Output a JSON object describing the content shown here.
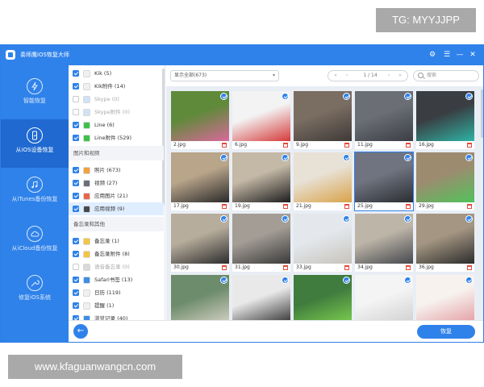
{
  "watermark_top": "TG: MYYJJPP",
  "watermark_bottom": "www.kfaguanwangcn.com",
  "app": {
    "title": "奏师鹰iOS恢复大师"
  },
  "nav": [
    {
      "label": "智能恢复",
      "active": false
    },
    {
      "label": "从iOS设备恢复",
      "active": true
    },
    {
      "label": "从iTunes备份恢复",
      "active": false
    },
    {
      "label": "从iCloud备份恢复",
      "active": false
    },
    {
      "label": "修复iOS系统",
      "active": false
    }
  ],
  "categories": {
    "rows_top": [
      {
        "label": "Kik (5)",
        "checked": true,
        "dim": false,
        "icon_color": "#f0f0f0"
      },
      {
        "label": "Kik附件 (14)",
        "checked": true,
        "dim": false,
        "icon_color": "#f0f0f0"
      },
      {
        "label": "Skype (0)",
        "checked": false,
        "dim": true,
        "icon_color": "#cfe3f7"
      },
      {
        "label": "Skype附件 (0)",
        "checked": false,
        "dim": true,
        "icon_color": "#cfe3f7"
      },
      {
        "label": "Line (6)",
        "checked": true,
        "dim": false,
        "icon_color": "#3cc24a"
      },
      {
        "label": "Line附件 (529)",
        "checked": true,
        "dim": false,
        "icon_color": "#3cc24a"
      }
    ],
    "section_media": "图片和视频",
    "rows_media": [
      {
        "label": "照片 (673)",
        "checked": true,
        "dim": false,
        "icon_color": "#f2a13b"
      },
      {
        "label": "视频 (27)",
        "checked": true,
        "dim": false,
        "icon_color": "#6a6f78"
      },
      {
        "label": "应用图片 (21)",
        "checked": true,
        "dim": false,
        "icon_color": "#e8664a"
      },
      {
        "label": "应用视频 (9)",
        "checked": true,
        "dim": false,
        "icon_color": "#44484f"
      }
    ],
    "section_memo": "备忘录和其他",
    "rows_memo": [
      {
        "label": "备忘录 (1)",
        "checked": true,
        "dim": false,
        "icon_color": "#f5c542"
      },
      {
        "label": "备忘录附件 (8)",
        "checked": true,
        "dim": false,
        "icon_color": "#f5c542"
      },
      {
        "label": "语音备忘录 (0)",
        "checked": false,
        "dim": true,
        "icon_color": "#d9d9d9"
      },
      {
        "label": "Safari书签 (13)",
        "checked": true,
        "dim": false,
        "icon_color": "#3a8ee6"
      },
      {
        "label": "日历 (119)",
        "checked": true,
        "dim": false,
        "icon_color": "#f0f0f0"
      },
      {
        "label": "提醒 (1)",
        "checked": true,
        "dim": false,
        "icon_color": "#f0f0f0"
      },
      {
        "label": "浏览记录 (40)",
        "checked": true,
        "dim": false,
        "icon_color": "#3a8ee6"
      }
    ]
  },
  "toolbar": {
    "filter_value": "显示全部(673)",
    "page_text": "1 / 14",
    "search_placeholder": "搜索"
  },
  "photos": [
    {
      "name": "2.jpg",
      "selected": false,
      "colors": [
        "#5f8a3a",
        "#d9699a"
      ]
    },
    {
      "name": "6.jpg",
      "selected": false,
      "colors": [
        "#f3f3f3",
        "#d53a3a"
      ]
    },
    {
      "name": "9.jpg",
      "selected": false,
      "colors": [
        "#7a6d62",
        "#3e3a37"
      ]
    },
    {
      "name": "11.jpg",
      "selected": false,
      "colors": [
        "#6b6e74",
        "#3b3f45"
      ]
    },
    {
      "name": "16.jpg",
      "selected": false,
      "colors": [
        "#3a3d42",
        "#2fb3a4"
      ]
    },
    {
      "name": "17.jpg",
      "selected": false,
      "colors": [
        "#b9a58a",
        "#2a2a2a"
      ]
    },
    {
      "name": "19.jpg",
      "selected": false,
      "colors": [
        "#c4b8a6",
        "#1e1e1e"
      ]
    },
    {
      "name": "21.jpg",
      "selected": false,
      "colors": [
        "#e8e1d6",
        "#d9a34a"
      ]
    },
    {
      "name": "25.jpg",
      "selected": true,
      "colors": [
        "#6f7480",
        "#2b2d31"
      ]
    },
    {
      "name": "29.jpg",
      "selected": false,
      "colors": [
        "#9d8b70",
        "#52c25a"
      ]
    },
    {
      "name": "30.jpg",
      "selected": false,
      "colors": [
        "#b7ad9c",
        "#2d2d2d"
      ]
    },
    {
      "name": "31.jpg",
      "selected": false,
      "colors": [
        "#a39d95",
        "#3a3a3a"
      ]
    },
    {
      "name": "33.jpg",
      "selected": false,
      "colors": [
        "#e4e8ec",
        "#c7c3bd"
      ]
    },
    {
      "name": "34.jpg",
      "selected": false,
      "colors": [
        "#bdb5a8",
        "#45484d"
      ]
    },
    {
      "name": "36.jpg",
      "selected": false,
      "colors": [
        "#a49682",
        "#2c2c2c"
      ]
    },
    {
      "name": "",
      "selected": false,
      "colors": [
        "#6d8c6b",
        "#d8d3c8"
      ]
    },
    {
      "name": "",
      "selected": false,
      "colors": [
        "#e9e9e9",
        "#2a2a2a"
      ]
    },
    {
      "name": "",
      "selected": false,
      "colors": [
        "#3f7c3e",
        "#7fd14f"
      ]
    },
    {
      "name": "",
      "selected": false,
      "colors": [
        "#f4f4f4",
        "#cfcfcf"
      ]
    },
    {
      "name": "",
      "selected": false,
      "colors": [
        "#f7f2ee",
        "#e39aa0"
      ]
    }
  ],
  "bottom": {
    "back_label": "←",
    "recover_label": "恢复"
  },
  "window_controls": {
    "settings": "⚙",
    "menu": "☰",
    "minimize": "—",
    "close": "✕"
  }
}
